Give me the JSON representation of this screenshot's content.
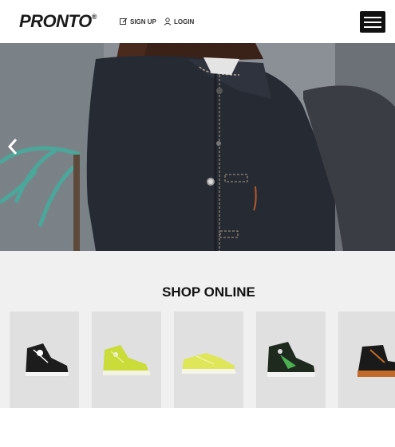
{
  "header": {
    "logo_text": "PRONTO",
    "logo_mark": "®",
    "signup_label": "SIGN UP",
    "login_label": "LOGIN"
  },
  "hero": {
    "prev_icon": "chevron-left-icon"
  },
  "shop": {
    "title": "SHOP ONLINE",
    "products": [
      {
        "name": "black-white-high-top-sneaker",
        "color": "#1c1c1c"
      },
      {
        "name": "lime-high-top-sneaker",
        "color": "#c9dc3a"
      },
      {
        "name": "lime-low-top-sneaker",
        "color": "#dfe65a"
      },
      {
        "name": "black-green-high-top-sneaker",
        "color": "#1f2a1f"
      },
      {
        "name": "black-brown-boot-sneaker",
        "color": "#c16a2a"
      }
    ]
  }
}
